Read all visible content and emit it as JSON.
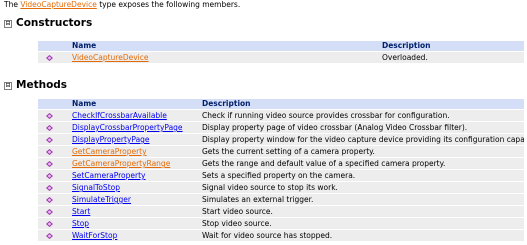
{
  "intro": {
    "before": "The ",
    "link": "VideoCaptureDevice",
    "after": " type exposes the following members."
  },
  "constructors": {
    "title": "Constructors",
    "toggle": "⊟",
    "headers": {
      "name": "Name",
      "description": "Description"
    },
    "rows": [
      {
        "name": "VideoCaptureDevice",
        "description": "Overloaded.",
        "visited": true
      }
    ]
  },
  "methods": {
    "title": "Methods",
    "toggle": "⊟",
    "headers": {
      "name": "Name",
      "description": "Description"
    },
    "rows": [
      {
        "name": "CheckIfCrossbarAvailable",
        "description": "Check if running video source provides crossbar for configuration.",
        "visited": false
      },
      {
        "name": "DisplayCrossbarPropertyPage",
        "description": "Display property page of video crossbar (Analog Video Crossbar filter).",
        "visited": false
      },
      {
        "name": "DisplayPropertyPage",
        "description": "Display property window for the video capture device providing its configuration capabilities.",
        "visited": false
      },
      {
        "name": "GetCameraProperty",
        "description": "Gets the current setting of a camera property.",
        "visited": true
      },
      {
        "name": "GetCameraPropertyRange",
        "description": "Gets the range and default value of a specified camera property.",
        "visited": true
      },
      {
        "name": "SetCameraProperty",
        "description": "Sets a specified property on the camera.",
        "visited": false
      },
      {
        "name": "SignalToStop",
        "description": "Signal video source to stop its work.",
        "visited": false
      },
      {
        "name": "SimulateTrigger",
        "description": "Simulates an external trigger.",
        "visited": false
      },
      {
        "name": "Start",
        "description": "Start video source.",
        "visited": false
      },
      {
        "name": "Stop",
        "description": "Stop video source.",
        "visited": false
      },
      {
        "name": "WaitForStop",
        "description": "Wait for video source has stopped.",
        "visited": false
      }
    ]
  },
  "colors": {
    "link": "#0000ee",
    "visited_link": "#e36c0a",
    "header_bg": "#d4dff7",
    "row_bg": "#ededed",
    "icon": "#9b2fae"
  }
}
